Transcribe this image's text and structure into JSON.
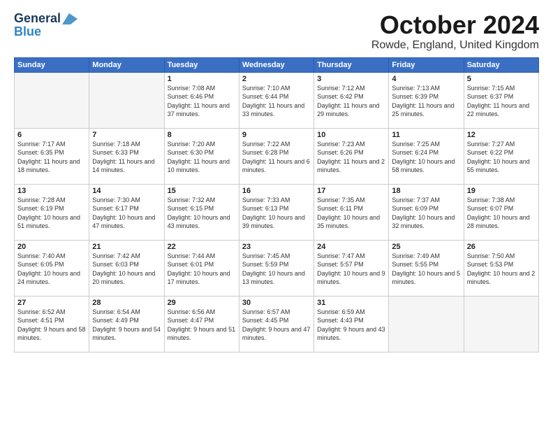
{
  "header": {
    "logo_line1": "General",
    "logo_line2": "Blue",
    "month_title": "October 2024",
    "location": "Rowde, England, United Kingdom"
  },
  "weekdays": [
    "Sunday",
    "Monday",
    "Tuesday",
    "Wednesday",
    "Thursday",
    "Friday",
    "Saturday"
  ],
  "weeks": [
    [
      {
        "day": "",
        "info": ""
      },
      {
        "day": "",
        "info": ""
      },
      {
        "day": "1",
        "info": "Sunrise: 7:08 AM\nSunset: 6:46 PM\nDaylight: 11 hours\nand 37 minutes."
      },
      {
        "day": "2",
        "info": "Sunrise: 7:10 AM\nSunset: 6:44 PM\nDaylight: 11 hours\nand 33 minutes."
      },
      {
        "day": "3",
        "info": "Sunrise: 7:12 AM\nSunset: 6:42 PM\nDaylight: 11 hours\nand 29 minutes."
      },
      {
        "day": "4",
        "info": "Sunrise: 7:13 AM\nSunset: 6:39 PM\nDaylight: 11 hours\nand 25 minutes."
      },
      {
        "day": "5",
        "info": "Sunrise: 7:15 AM\nSunset: 6:37 PM\nDaylight: 11 hours\nand 22 minutes."
      }
    ],
    [
      {
        "day": "6",
        "info": "Sunrise: 7:17 AM\nSunset: 6:35 PM\nDaylight: 11 hours\nand 18 minutes."
      },
      {
        "day": "7",
        "info": "Sunrise: 7:18 AM\nSunset: 6:33 PM\nDaylight: 11 hours\nand 14 minutes."
      },
      {
        "day": "8",
        "info": "Sunrise: 7:20 AM\nSunset: 6:30 PM\nDaylight: 11 hours\nand 10 minutes."
      },
      {
        "day": "9",
        "info": "Sunrise: 7:22 AM\nSunset: 6:28 PM\nDaylight: 11 hours\nand 6 minutes."
      },
      {
        "day": "10",
        "info": "Sunrise: 7:23 AM\nSunset: 6:26 PM\nDaylight: 11 hours\nand 2 minutes."
      },
      {
        "day": "11",
        "info": "Sunrise: 7:25 AM\nSunset: 6:24 PM\nDaylight: 10 hours\nand 58 minutes."
      },
      {
        "day": "12",
        "info": "Sunrise: 7:27 AM\nSunset: 6:22 PM\nDaylight: 10 hours\nand 55 minutes."
      }
    ],
    [
      {
        "day": "13",
        "info": "Sunrise: 7:28 AM\nSunset: 6:19 PM\nDaylight: 10 hours\nand 51 minutes."
      },
      {
        "day": "14",
        "info": "Sunrise: 7:30 AM\nSunset: 6:17 PM\nDaylight: 10 hours\nand 47 minutes."
      },
      {
        "day": "15",
        "info": "Sunrise: 7:32 AM\nSunset: 6:15 PM\nDaylight: 10 hours\nand 43 minutes."
      },
      {
        "day": "16",
        "info": "Sunrise: 7:33 AM\nSunset: 6:13 PM\nDaylight: 10 hours\nand 39 minutes."
      },
      {
        "day": "17",
        "info": "Sunrise: 7:35 AM\nSunset: 6:11 PM\nDaylight: 10 hours\nand 35 minutes."
      },
      {
        "day": "18",
        "info": "Sunrise: 7:37 AM\nSunset: 6:09 PM\nDaylight: 10 hours\nand 32 minutes."
      },
      {
        "day": "19",
        "info": "Sunrise: 7:38 AM\nSunset: 6:07 PM\nDaylight: 10 hours\nand 28 minutes."
      }
    ],
    [
      {
        "day": "20",
        "info": "Sunrise: 7:40 AM\nSunset: 6:05 PM\nDaylight: 10 hours\nand 24 minutes."
      },
      {
        "day": "21",
        "info": "Sunrise: 7:42 AM\nSunset: 6:03 PM\nDaylight: 10 hours\nand 20 minutes."
      },
      {
        "day": "22",
        "info": "Sunrise: 7:44 AM\nSunset: 6:01 PM\nDaylight: 10 hours\nand 17 minutes."
      },
      {
        "day": "23",
        "info": "Sunrise: 7:45 AM\nSunset: 5:59 PM\nDaylight: 10 hours\nand 13 minutes."
      },
      {
        "day": "24",
        "info": "Sunrise: 7:47 AM\nSunset: 5:57 PM\nDaylight: 10 hours\nand 9 minutes."
      },
      {
        "day": "25",
        "info": "Sunrise: 7:49 AM\nSunset: 5:55 PM\nDaylight: 10 hours\nand 5 minutes."
      },
      {
        "day": "26",
        "info": "Sunrise: 7:50 AM\nSunset: 5:53 PM\nDaylight: 10 hours\nand 2 minutes."
      }
    ],
    [
      {
        "day": "27",
        "info": "Sunrise: 6:52 AM\nSunset: 4:51 PM\nDaylight: 9 hours\nand 58 minutes."
      },
      {
        "day": "28",
        "info": "Sunrise: 6:54 AM\nSunset: 4:49 PM\nDaylight: 9 hours\nand 54 minutes."
      },
      {
        "day": "29",
        "info": "Sunrise: 6:56 AM\nSunset: 4:47 PM\nDaylight: 9 hours\nand 51 minutes."
      },
      {
        "day": "30",
        "info": "Sunrise: 6:57 AM\nSunset: 4:45 PM\nDaylight: 9 hours\nand 47 minutes."
      },
      {
        "day": "31",
        "info": "Sunrise: 6:59 AM\nSunset: 4:43 PM\nDaylight: 9 hours\nand 43 minutes."
      },
      {
        "day": "",
        "info": ""
      },
      {
        "day": "",
        "info": ""
      }
    ]
  ]
}
